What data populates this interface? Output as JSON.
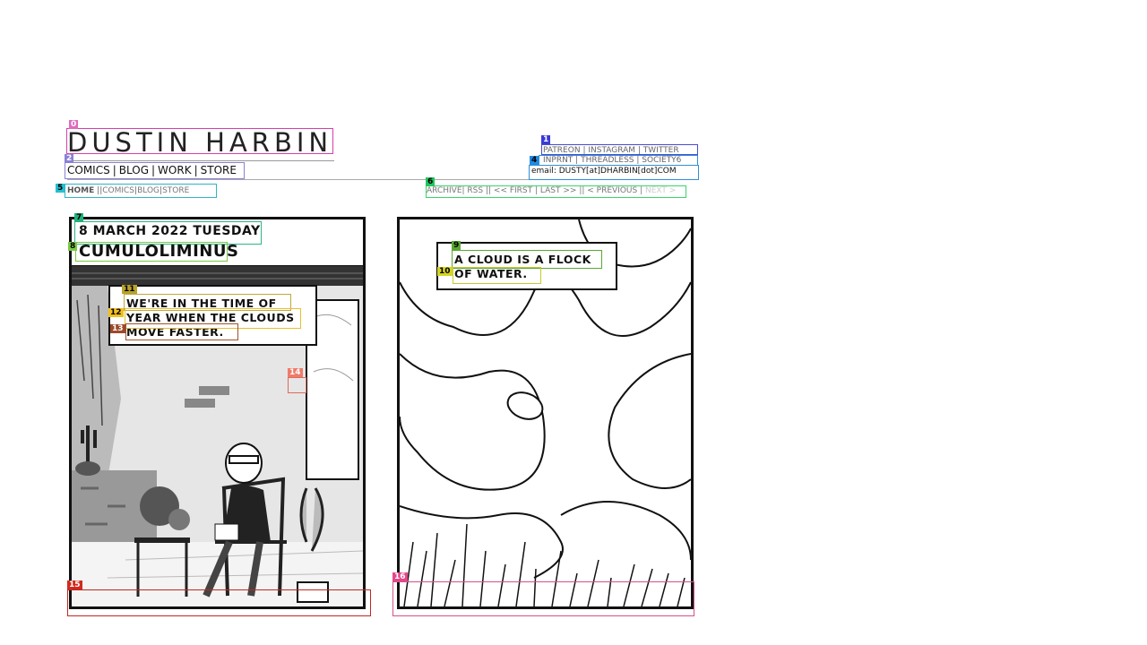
{
  "header": {
    "site_title": "DUSTIN HARBIN",
    "main_nav": [
      "COMICS",
      "BLOG",
      "WORK",
      "STORE"
    ],
    "social_row_1": [
      "PATREON",
      "INSTAGRAM",
      "TWITTER"
    ],
    "social_row_2": [
      "INPRNT",
      "THREADLESS",
      "SOCIETY6"
    ],
    "email": "email: DUSTY[at]DHARBIN[dot]COM"
  },
  "sub_nav": {
    "home": "HOME",
    "items": [
      "COMICS",
      "BLOG",
      "STORE"
    ]
  },
  "comic_nav": {
    "archive": "ARCHIVE",
    "rss": "RSS",
    "first": "<< FIRST",
    "last": "LAST >>",
    "previous": "< PREVIOUS",
    "next": "NEXT >"
  },
  "comic": {
    "date": "8 MARCH 2022 TUESDAY",
    "title": "CUMULOLIMINUS",
    "left_caption": [
      "WE'RE IN THE TIME OF",
      "YEAR WHEN THE CLOUDS",
      "MOVE FASTER."
    ],
    "right_caption": [
      "A CLOUD IS A FLOCK",
      "OF WATER."
    ]
  },
  "overlay_tags": [
    "0",
    "1",
    "2",
    "4",
    "5",
    "6",
    "7",
    "8",
    "9",
    "10",
    "11",
    "12",
    "13",
    "14",
    "15",
    "16"
  ],
  "colors": {
    "ink": "#111111",
    "nav_gray": "#777777",
    "disabled": "#cccccc"
  }
}
